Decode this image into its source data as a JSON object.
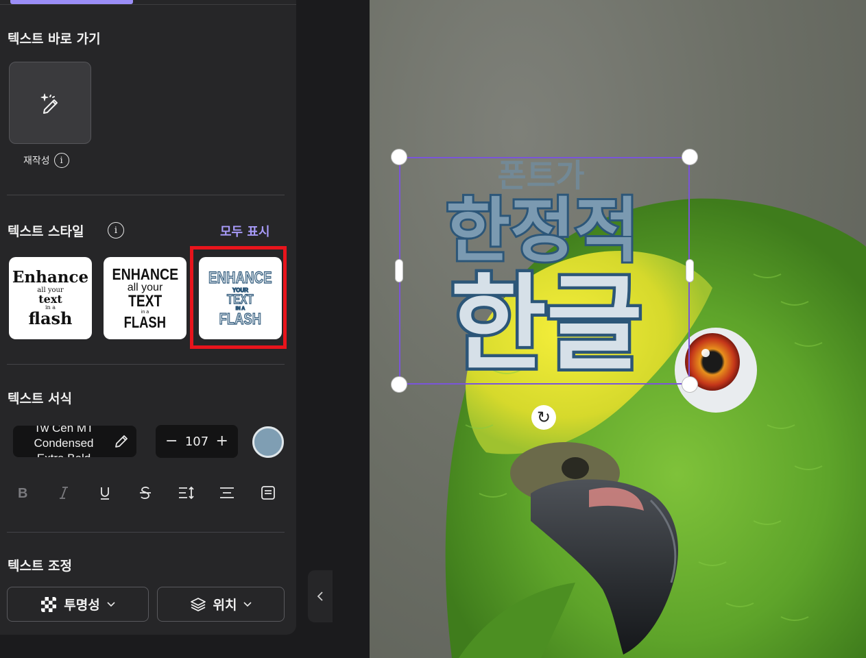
{
  "sidebar": {
    "rewrite_section": {
      "title": "텍스트 바로 가기",
      "tile_label": "재작성",
      "info_glyph": "i"
    },
    "text_style_section": {
      "title": "텍스트 스타일",
      "info_glyph": "i",
      "show_all": "모두 표시",
      "cards": [
        {
          "lines": [
            "Enhance",
            "all your",
            "text",
            "in a",
            "flash"
          ]
        },
        {
          "lines": [
            "ENHANCE",
            "all your",
            "TEXT",
            "in a",
            "FLASH"
          ]
        },
        {
          "lines": [
            "ENHANCE",
            "YOUR",
            "TEXT",
            "IN A",
            "FLASH"
          ],
          "selected": true
        }
      ]
    },
    "text_format_section": {
      "title": "텍스트 서식",
      "font_lines": [
        "Tw Cen MT",
        "Condensed",
        "Extra Bold"
      ],
      "size_minus": "−",
      "font_size": "107",
      "size_plus": "+",
      "color": "#7f9eb3"
    },
    "text_adjust_section": {
      "title": "텍스트 조정",
      "opacity_label": "투명성",
      "position_label": "위치"
    }
  },
  "canvas": {
    "text_small": "폰트가",
    "text_medium": "한정적",
    "text_large": "한글",
    "rotate_glyph": "↻"
  },
  "collapse_button": {
    "glyph": "‹"
  },
  "colors": {
    "accent": "#9b8ef7",
    "highlight_box": "#e8141c",
    "selection": "#7a55d9",
    "text_fill": "#c9d6df",
    "text_outline": "#2c5678"
  }
}
